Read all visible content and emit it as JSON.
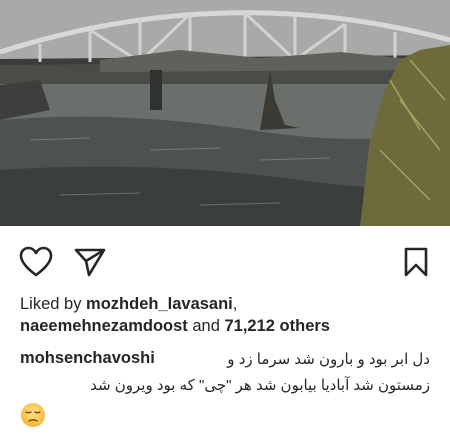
{
  "post": {
    "image": {
      "description_icon": "photo-flooded-river-bridge"
    },
    "actions": {
      "like_icon": "heart-icon",
      "share_icon": "paper-plane-icon",
      "save_icon": "bookmark-icon"
    },
    "likes": {
      "prefix": "Liked by ",
      "user1": "mozhdeh_lavasani",
      "separator": ",",
      "user2": "naeemehnezamdoost",
      "middle": " and ",
      "count": "71,212 others"
    },
    "caption": {
      "username": "mohsenchavoshi",
      "line1": "دل ابر بود و بارون شد  سرما زد و",
      "line2": "زمستون شد آبادیا بیابون شد  هر \"چی\" که بود ویرون شد",
      "emoji_icon": "pensive-face-icon"
    }
  }
}
